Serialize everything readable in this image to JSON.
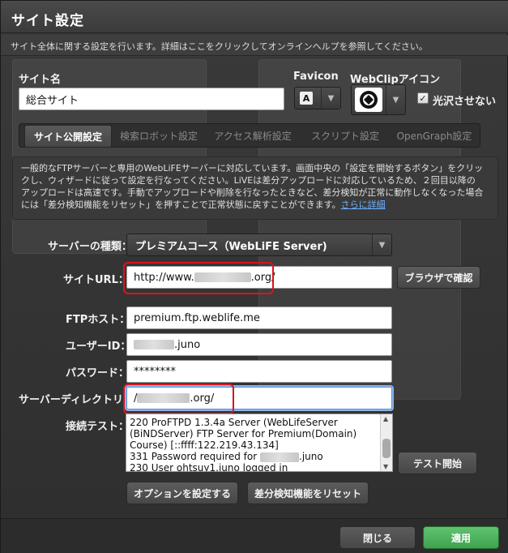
{
  "window": {
    "title": "サイト設定",
    "help_text": "サイト全体に関する設定を行います。詳細はここをクリックしてオンラインヘルプを参照してください。"
  },
  "site_name": {
    "label": "サイト名",
    "value": "総合サイト"
  },
  "favicon": {
    "label": "Favicon",
    "glyph": "A"
  },
  "webclip": {
    "label": "WebClipアイコン",
    "gloss_label": "光沢させない",
    "gloss_checked": true
  },
  "tabs": [
    {
      "label": "サイト公開設定",
      "active": true
    },
    {
      "label": "検索ロボット設定",
      "active": false
    },
    {
      "label": "アクセス解析設定",
      "active": false
    },
    {
      "label": "スクリプト設定",
      "active": false
    },
    {
      "label": "OpenGraph設定",
      "active": false
    }
  ],
  "description": {
    "line1": "一般的なFTPサーバーと専用のWebLiFEサーバーに対応しています。画面中央の「設定を開始するボタン」をクリッ",
    "line2": "クし、ウィザードに従って設定を行なってください。LiVEは差分アップロードに対応しているため、２回目以降の",
    "line3": "アップロードは高速です。手動でアップロードや削除を行なったときなど、差分検知が正常に動作しなくなった場合",
    "line4": "には「差分検知機能をリセット」を押すことで正常状態に戻すことができます。",
    "link": "さらに詳細"
  },
  "server_type": {
    "label": "サーバーの種類：",
    "value": "プレミアムコース（WebLiFE Server)"
  },
  "site_url": {
    "label": "サイトURL：",
    "prefix": "http://www.",
    "suffix": ".org/",
    "button": "ブラウザで確認"
  },
  "ftp_host": {
    "label": "FTPホスト：",
    "value": "premium.ftp.weblife.me"
  },
  "user_id": {
    "label": "ユーザーID：",
    "suffix": ".juno"
  },
  "password": {
    "label": "パスワード：",
    "value": "********"
  },
  "server_dir": {
    "label": "サーバーディレクトリ：",
    "prefix": "/",
    "suffix": ".org/"
  },
  "connection_test": {
    "label": "接続テスト：",
    "lines": [
      "220 ProFTPD 1.3.4a Server (WebLifeServer",
      "(BiNDServer) FTP Server for Premium(Domain)",
      "Course) [::ffff:122.219.43.134]",
      "331 Password required for",
      "230 User ohtsuy1.juno logged in"
    ],
    "line4_suffix": ".juno",
    "button": "テスト開始"
  },
  "buttons": {
    "options": "オプションを設定する",
    "reset_diff": "差分検知機能をリセット",
    "close": "閉じる",
    "apply": "適用"
  },
  "colors": {
    "highlight": "#d9151d",
    "apply": "#4cb35c",
    "link": "#6bb0ff"
  }
}
